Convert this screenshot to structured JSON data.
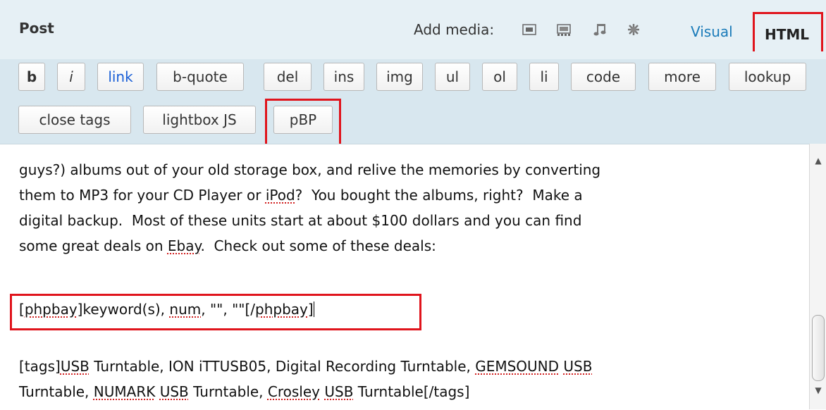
{
  "header": {
    "title": "Post",
    "add_media_label": "Add media:",
    "media_icons": [
      "image-icon",
      "video-icon",
      "audio-icon",
      "media-star-icon"
    ],
    "tabs": [
      {
        "label": "Visual",
        "active": false
      },
      {
        "label": "HTML",
        "active": true
      }
    ]
  },
  "toolbar": {
    "buttons": [
      "b",
      "i",
      "link",
      "b-quote",
      "del",
      "ins",
      "img",
      "ul",
      "ol",
      "li",
      "code",
      "more",
      "lookup",
      "close tags",
      "lightbox JS",
      "pBP"
    ]
  },
  "editor": {
    "lines": [
      "guys?) albums out of your old storage box, and relive the memories by converting",
      "them to MP3 for your CD Player or iPod?  You bought the albums, right?  Make a",
      "digital backup.  Most of these units start at about $100 dollars and you can find",
      "some great deals on Ebay.  Check out some of these deals:",
      "[phpbay]keyword(s), num, \"\", \"\"[/phpbay]",
      "[tags]USB Turntable, ION iTTUSB05, Digital Recording Turntable, GEMSOUND USB",
      "Turntable, NUMARK USB Turntable, Crosley USB Turntable[/tags]"
    ]
  },
  "colors": {
    "header_bg": "#e6f0f5",
    "toolbar_bg": "#d8e7ef",
    "highlight_red": "#e0141c",
    "link_blue": "#1a7bb9"
  }
}
